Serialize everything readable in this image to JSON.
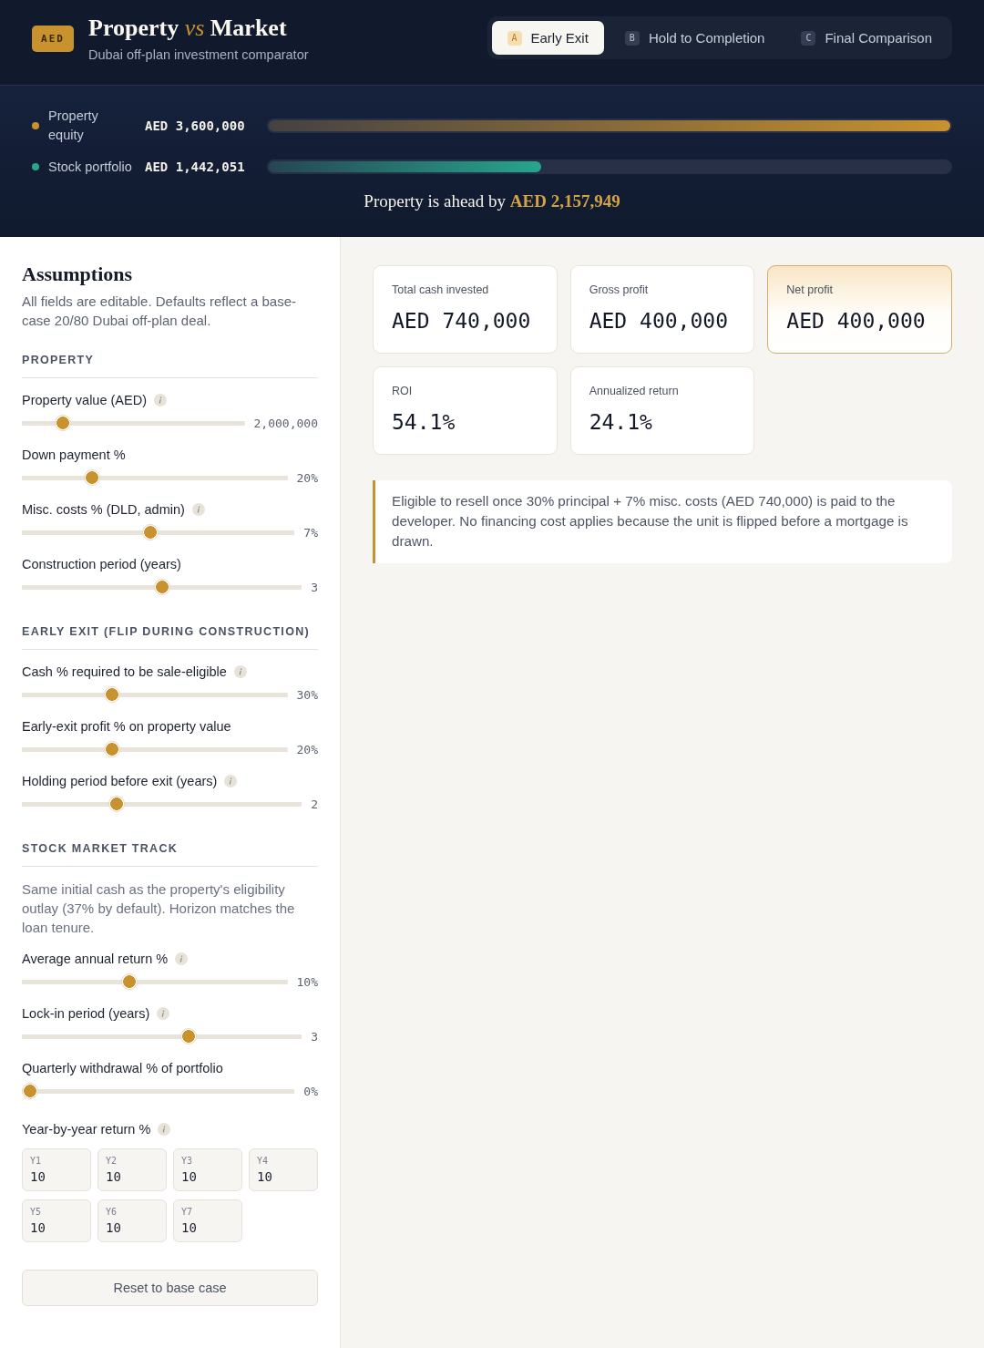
{
  "header": {
    "badge": "AED",
    "title": "Property *vs* Market",
    "subtitle": "Dubai off-plan investment comparator"
  },
  "tabs": [
    {
      "key": "A",
      "label": "Early Exit",
      "selected": true
    },
    {
      "key": "B",
      "label": "Hold to Completion",
      "selected": false
    },
    {
      "key": "C",
      "label": "Final Comparison",
      "selected": false
    }
  ],
  "comparison": {
    "rows": [
      {
        "label": "Property equity",
        "value": "AED 3,600,000",
        "color": "#c8922f",
        "level": 1
      },
      {
        "label": "Stock portfolio",
        "value": "AED 1,442,051",
        "color": "#26a68c",
        "level": 0.4
      }
    ],
    "verdict": "Property is ahead by **AED 2,157,949**"
  },
  "assumptions": {
    "title": "Assumptions",
    "description": "All fields are editable. Defaults reflect a base-case 20/80 Dubai off-plan deal.",
    "sections": [
      {
        "heading": "PROPERTY",
        "fields": [
          {
            "kind": "slider",
            "label": "Property value (AED)",
            "info": true,
            "value": "2,000,000",
            "level": 0.16
          },
          {
            "kind": "slider",
            "label": "Down payment %",
            "info": false,
            "value": "20%",
            "level": 0.25
          },
          {
            "kind": "slider",
            "label": "Misc. costs % (DLD, admin)",
            "info": true,
            "value": "7%",
            "level": 0.47
          },
          {
            "kind": "slider",
            "label": "Construction period (years)",
            "info": false,
            "value": "3",
            "level": 0.5
          }
        ]
      },
      {
        "heading": "EARLY EXIT (FLIP DURING CONSTRUCTION)",
        "fields": [
          {
            "kind": "slider",
            "label": "Cash % required to be sale-eligible",
            "info": true,
            "value": "30%",
            "level": 0.33
          },
          {
            "kind": "slider",
            "label": "Early-exit profit % on property value",
            "info": false,
            "value": "20%",
            "level": 0.33
          },
          {
            "kind": "slider",
            "label": "Holding period before exit (years)",
            "info": true,
            "value": "2",
            "level": 0.33
          }
        ]
      },
      {
        "heading": "STOCK MARKET TRACK",
        "note": "Same initial cash as the property's eligibility outlay (37% by default). Horizon matches the loan tenure.",
        "fields": [
          {
            "kind": "slider",
            "label": "Average annual return %",
            "info": true,
            "value": "10%",
            "level": 0.4
          },
          {
            "kind": "slider",
            "label": "Lock-in period (years)",
            "info": true,
            "value": "3",
            "level": 0.6
          },
          {
            "kind": "slider",
            "label": "Quarterly withdrawal % of portfolio",
            "info": false,
            "value": "0%",
            "level": 0
          },
          {
            "kind": "year_grid",
            "label": "Year-by-year return %",
            "info": true,
            "cells": [
              {
                "label": "Y1",
                "value": "10"
              },
              {
                "label": "Y2",
                "value": "10"
              },
              {
                "label": "Y3",
                "value": "10"
              },
              {
                "label": "Y4",
                "value": "10"
              },
              {
                "label": "Y5",
                "value": "10"
              },
              {
                "label": "Y6",
                "value": "10"
              },
              {
                "label": "Y7",
                "value": "10"
              }
            ]
          }
        ]
      }
    ],
    "reset_button": "Reset to base case"
  },
  "results": {
    "metrics": [
      {
        "label": "Total cash invested",
        "value": "AED 740,000",
        "highlight": false
      },
      {
        "label": "Gross profit",
        "value": "AED 400,000",
        "highlight": false
      },
      {
        "label": "Net profit",
        "value": "AED 400,000",
        "highlight": true
      },
      {
        "label": "ROI",
        "value": "54.1%",
        "highlight": false
      },
      {
        "label": "Annualized return",
        "value": "24.1%",
        "highlight": false
      }
    ],
    "note": "Eligible to resell once 30% principal + 7% misc. costs (AED 740,000) is paid to the developer. No financing cost applies because the unit is flipped before a mortgage is drawn."
  }
}
